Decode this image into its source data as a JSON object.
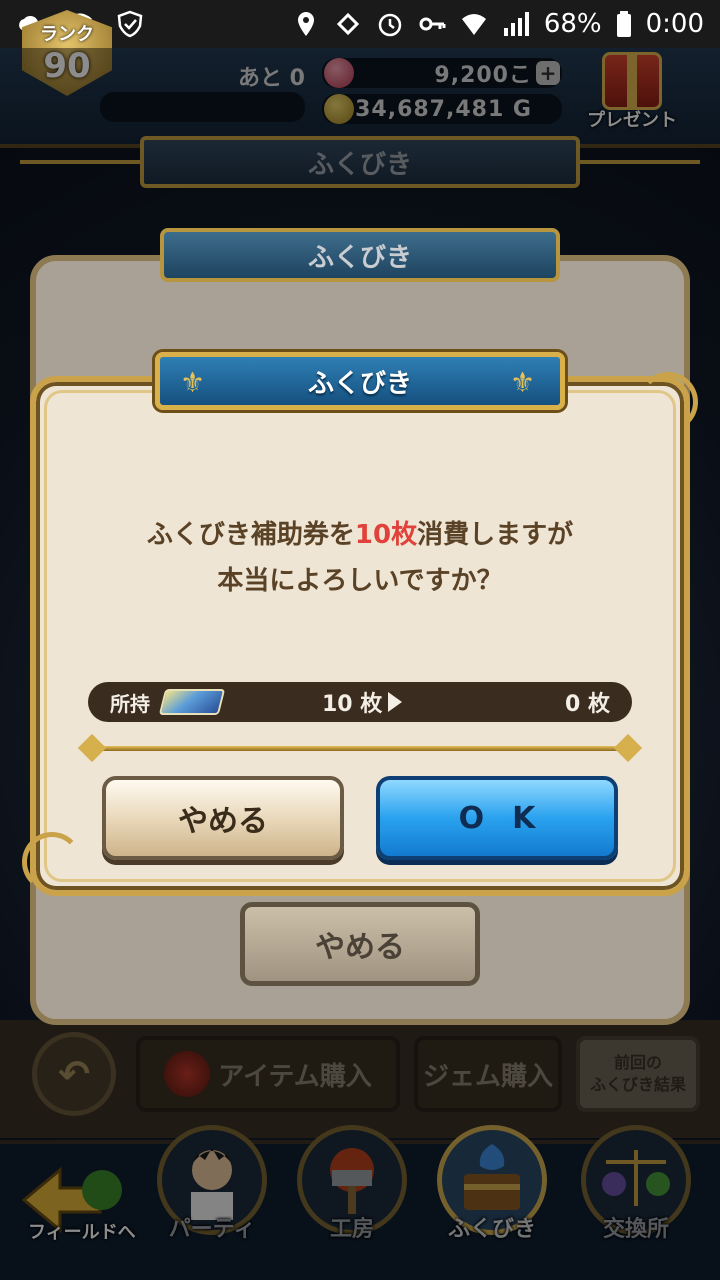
{
  "status_bar": {
    "battery_percent": "68%",
    "time": "0:00",
    "icons_left": [
      "cloud-icon",
      "vpn-icon",
      "shield-check-icon"
    ],
    "icons_right": [
      "location-icon",
      "nfc-icon",
      "alarm-icon",
      "key-icon",
      "wifi-icon",
      "signal-icon",
      "battery-icon"
    ]
  },
  "header": {
    "rank_label": "ランク",
    "rank_value": "90",
    "stamina_label": "あと 0",
    "gems": "9,200こ",
    "gold": "34,687,481 G",
    "present_label": "プレゼント"
  },
  "page": {
    "title": "ふくびき"
  },
  "back_dialog": {
    "title": "ふくびき",
    "cancel_label": "やめる"
  },
  "dialog": {
    "title": "ふくびき",
    "message_line1_prefix": "ふくびき補助券を",
    "message_line1_highlight": "10枚",
    "message_line1_suffix": "消費しますが",
    "message_line2": "本当によろしいですか？",
    "owned_label": "所持",
    "owned_before": "10 枚",
    "owned_after": "0 枚",
    "cancel_label": "やめる",
    "ok_label": "OK",
    "highlight_color": "#e0413a"
  },
  "action_bar": {
    "back_icon": "undo-arrow-icon",
    "buy_items_label": "アイテム購入",
    "buy_gems_label": "ジェム購入",
    "prev_results_line1": "前回の",
    "prev_results_line2": "ふくびき結果"
  },
  "bottom_nav": {
    "field_label": "フィールドへ",
    "party_label": "パーティ",
    "workshop_label": "工房",
    "fukubiki_label": "ふくびき",
    "exchange_label": "交換所",
    "active": "ふくびき"
  }
}
